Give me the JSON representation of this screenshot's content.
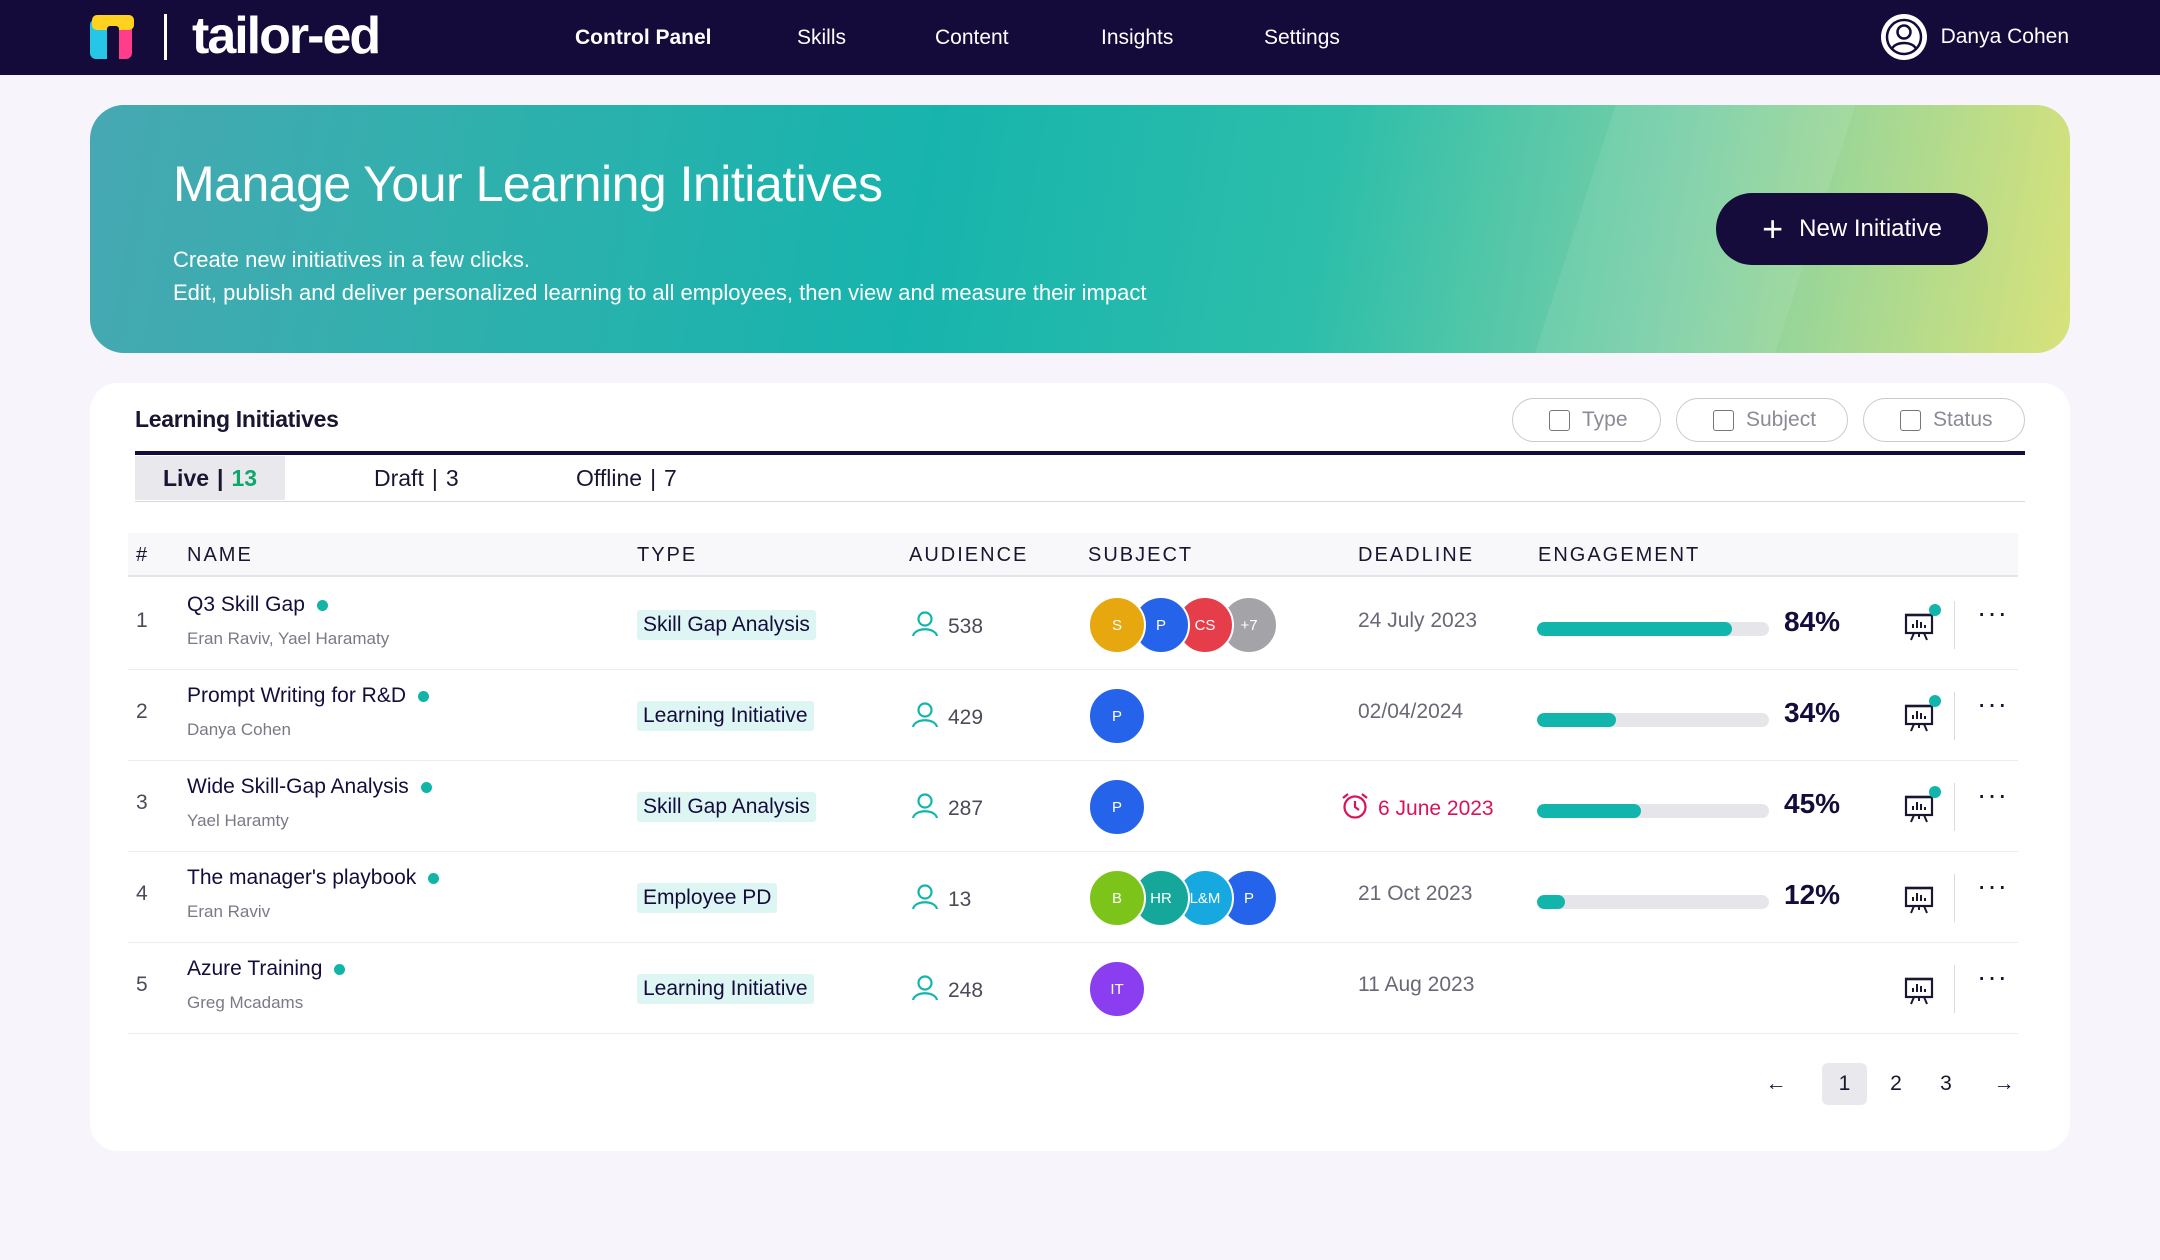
{
  "app": {
    "logo_text": "tailor-ed",
    "nav": [
      {
        "label": "Control Panel",
        "active": true
      },
      {
        "label": "Skills"
      },
      {
        "label": "Content"
      },
      {
        "label": "Insights"
      },
      {
        "label": "Settings"
      }
    ],
    "user_name": "Danya Cohen"
  },
  "hero": {
    "title": "Manage Your Learning Initiatives",
    "subtitle_line1": "Create new initiatives in a few clicks.",
    "subtitle_line2": "Edit, publish and deliver personalized learning to all employees, then view and measure their impact",
    "new_button": "New Initiative"
  },
  "initiatives": {
    "title": "Learning Initiatives",
    "filters": [
      "Type",
      "Subject",
      "Status"
    ],
    "tabs": [
      {
        "label": "Live",
        "count": "13",
        "active": true
      },
      {
        "label": "Draft",
        "count": "3"
      },
      {
        "label": "Offline",
        "count": "7"
      }
    ],
    "columns": [
      "#",
      "NAME",
      "TYPE",
      "AUDIENCE",
      "SUBJECT",
      "DEADLINE",
      "ENGAGEMENT"
    ],
    "rows": [
      {
        "num": "1",
        "name": "Q3 Skill Gap",
        "owners": "Eran Raviv, Yael Haramaty",
        "type": "Skill Gap Analysis",
        "audience": "538",
        "subjects": [
          {
            "label": "S",
            "color": "#e7a70e"
          },
          {
            "label": "P",
            "color": "#2563eb"
          },
          {
            "label": "CS",
            "color": "#e53e4a"
          },
          {
            "label": "+7",
            "color": "#a3a3a8"
          }
        ],
        "deadline": "24 July 2023",
        "overdue": false,
        "engagement": 0.84,
        "engagement_label": "84%",
        "notify": true
      },
      {
        "num": "2",
        "name": "Prompt Writing for R&D",
        "owners": "Danya Cohen",
        "type": "Learning Initiative",
        "audience": "429",
        "subjects": [
          {
            "label": "P",
            "color": "#2563eb"
          }
        ],
        "deadline": "02/04/2024",
        "overdue": false,
        "engagement": 0.34,
        "engagement_label": "34%",
        "notify": true
      },
      {
        "num": "3",
        "name": "Wide Skill-Gap Analysis",
        "owners": "Yael Haramty",
        "type": "Skill Gap Analysis",
        "audience": "287",
        "subjects": [
          {
            "label": "P",
            "color": "#2563eb"
          }
        ],
        "deadline": "6 June 2023",
        "overdue": true,
        "engagement": 0.45,
        "engagement_label": "45%",
        "notify": true
      },
      {
        "num": "4",
        "name": "The manager's playbook",
        "owners": "Eran Raviv",
        "type": "Employee PD",
        "audience": "13",
        "subjects": [
          {
            "label": "B",
            "color": "#7cc41a"
          },
          {
            "label": "HR",
            "color": "#15a89a"
          },
          {
            "label": "L&M",
            "color": "#16a9e0"
          },
          {
            "label": "P",
            "color": "#2563eb"
          }
        ],
        "deadline": "21 Oct 2023",
        "overdue": false,
        "engagement": 0.12,
        "engagement_label": "12%",
        "notify": false
      },
      {
        "num": "5",
        "name": "Azure Training",
        "owners": "Greg Mcadams",
        "type": "Learning Initiative",
        "audience": "248",
        "subjects": [
          {
            "label": "IT",
            "color": "#8a3ef0"
          }
        ],
        "deadline": "11 Aug 2023",
        "overdue": false,
        "engagement": null,
        "engagement_label": "",
        "notify": false
      }
    ],
    "pagination": {
      "pages": [
        "1",
        "2",
        "3"
      ],
      "current": "1"
    }
  },
  "colors": {
    "nav_bg": "#140b3a",
    "accent": "#12b5ab",
    "overdue": "#d8135c",
    "live_count": "#0ea86a"
  }
}
